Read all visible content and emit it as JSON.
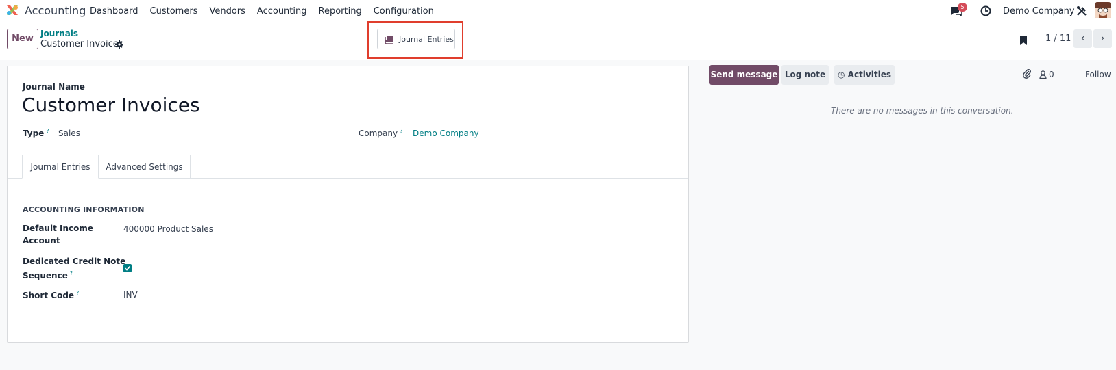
{
  "app": {
    "name": "Accounting"
  },
  "menu": [
    "Dashboard",
    "Customers",
    "Vendors",
    "Accounting",
    "Reporting",
    "Configuration"
  ],
  "systray": {
    "message_count": "5",
    "company": "Demo Company"
  },
  "control_panel": {
    "new_label": "New",
    "breadcrumb_parent": "Journals",
    "breadcrumb_current": "Customer Invoices",
    "smart_button_label": "Journal Entries",
    "pager": "1 / 11"
  },
  "form": {
    "journal_name_label": "Journal Name",
    "journal_name": "Customer Invoices",
    "type_label": "Type",
    "type_value": "Sales",
    "company_label": "Company",
    "company_value": "Demo Company",
    "tabs": [
      "Journal Entries",
      "Advanced Settings"
    ],
    "section_title": "ACCOUNTING INFORMATION",
    "default_income_label_1": "Default Income",
    "default_income_label_2": "Account",
    "default_income_value": "400000 Product Sales",
    "credit_note_label_1": "Dedicated Credit Note",
    "credit_note_label_2": "Sequence",
    "credit_note_checked": true,
    "short_code_label": "Short Code",
    "short_code_value": "INV",
    "help_mark": "?"
  },
  "chatter": {
    "send_message": "Send message",
    "log_note": "Log note",
    "activities": "Activities",
    "followers": "0",
    "follow": "Follow",
    "empty_text": "There are no messages in this conversation."
  },
  "colors": {
    "brand": "#714b67",
    "teal": "#017e84",
    "highlight": "#e03e2d",
    "badge": "#d44c59"
  }
}
